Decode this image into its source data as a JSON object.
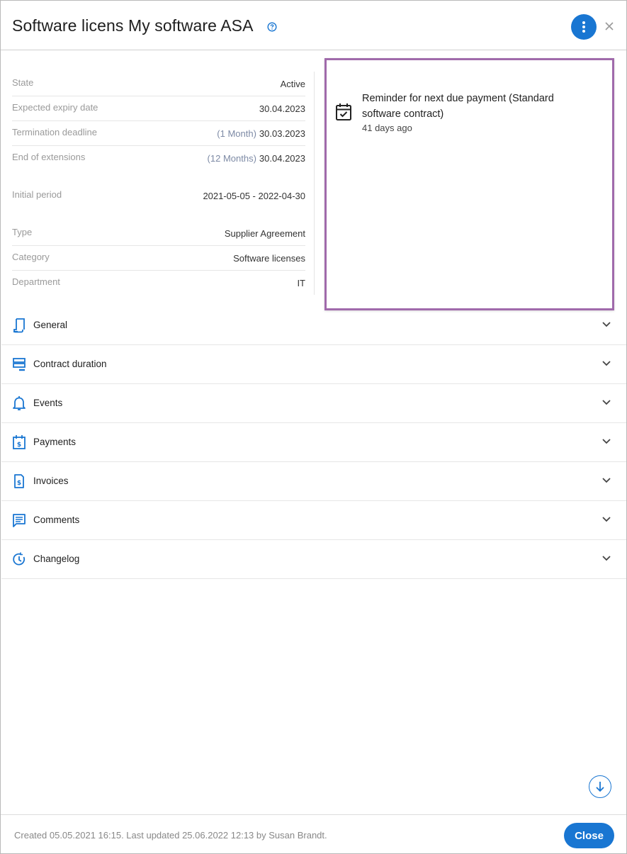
{
  "header": {
    "title": "Software licens My software ASA",
    "help_icon": "help-circle-icon",
    "menu_icon": "more-vertical-icon",
    "close_icon": "close-icon"
  },
  "details": [
    {
      "label": "State",
      "value": "Active",
      "muted": ""
    },
    {
      "label": "Expected expiry date",
      "value": "30.04.2023",
      "muted": ""
    },
    {
      "label": "Termination deadline",
      "value": "30.03.2023",
      "muted": "(1 Month)"
    },
    {
      "label": "End of extensions",
      "value": "30.04.2023",
      "muted": "(12 Months)"
    },
    {
      "label": "Initial period",
      "value": "2021-05-05 - 2022-04-30",
      "muted": ""
    },
    {
      "label": "Type",
      "value": "Supplier Agreement",
      "muted": ""
    },
    {
      "label": "Category",
      "value": "Software licenses",
      "muted": ""
    },
    {
      "label": "Department",
      "value": "IT",
      "muted": ""
    }
  ],
  "reminder": {
    "icon": "calendar-check-icon",
    "title": "Reminder for next due payment (Standard software contract)",
    "time": "41 days ago"
  },
  "sections": [
    {
      "label": "General",
      "icon": "document-icon"
    },
    {
      "label": "Contract duration",
      "icon": "list-icon"
    },
    {
      "label": "Events",
      "icon": "bell-icon"
    },
    {
      "label": "Payments",
      "icon": "calendar-dollar-icon"
    },
    {
      "label": "Invoices",
      "icon": "invoice-icon"
    },
    {
      "label": "Comments",
      "icon": "comment-icon"
    },
    {
      "label": "Changelog",
      "icon": "history-icon"
    }
  ],
  "footer": {
    "text": "Created 05.05.2021 16:15. Last updated 25.06.2022 12:13 by Susan Brandt.",
    "close_label": "Close",
    "scroll_icon": "arrow-down-icon"
  },
  "colors": {
    "accent": "#1976d2",
    "highlight_border": "#a06aab"
  }
}
